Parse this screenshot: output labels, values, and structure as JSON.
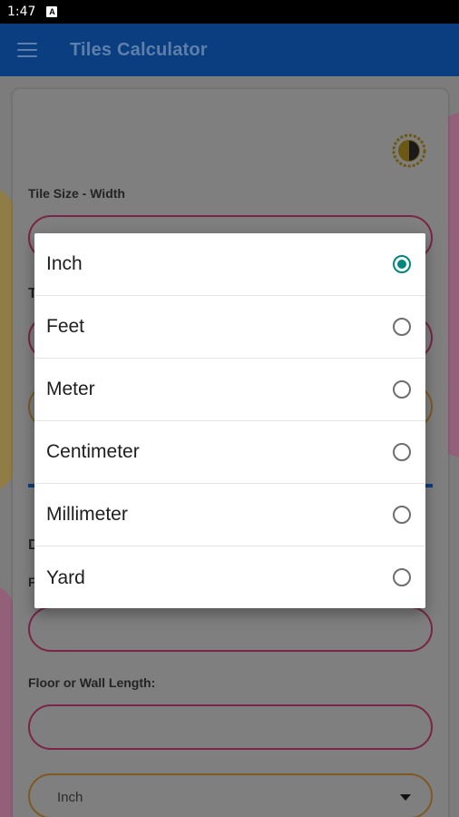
{
  "status_bar": {
    "time": "1:47",
    "notification_glyph": "A"
  },
  "app_bar": {
    "title": "Tiles Calculator"
  },
  "form": {
    "tile_width_label": "Tile Size - Width",
    "partial_label_t": "T",
    "partial_label_d": "D",
    "partial_label_f": "F",
    "floor_length_label": "Floor or Wall Length:",
    "unit_select_value": "Inch"
  },
  "unit_dialog": {
    "options": [
      {
        "label": "Inch",
        "selected": true
      },
      {
        "label": "Feet",
        "selected": false
      },
      {
        "label": "Meter",
        "selected": false
      },
      {
        "label": "Centimeter",
        "selected": false
      },
      {
        "label": "Millimeter",
        "selected": false
      },
      {
        "label": "Yard",
        "selected": false
      }
    ]
  },
  "colors": {
    "app_bar": "#0b3e80",
    "radio_selected": "#00897b",
    "field_border_pink": "#e0336f",
    "field_border_orange": "#f0a030"
  }
}
